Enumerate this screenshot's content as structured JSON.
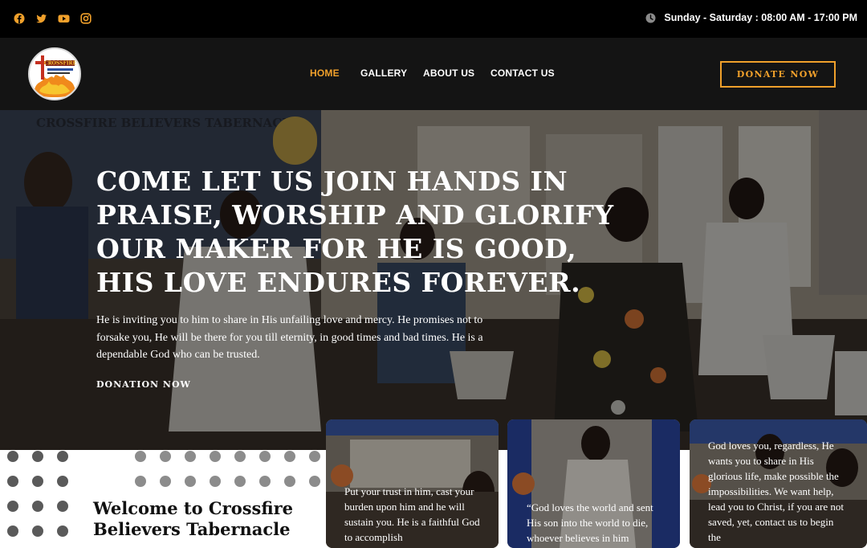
{
  "topbar": {
    "social": [
      "facebook-icon",
      "twitter-icon",
      "youtube-icon",
      "instagram-icon"
    ],
    "hours": "Sunday - Saturday : 08:00 AM - 17:00 PM"
  },
  "brand": {
    "accent": "#f0a02b",
    "logo_text": "CROSSFIRE"
  },
  "nav": {
    "items": [
      "HOME",
      "GALLERY",
      "ABOUT US",
      "CONTACT US"
    ],
    "active": "HOME",
    "donate": "DONATE NOW"
  },
  "hero": {
    "banner": "CROSSFIRE BELIEVERS TABERNACLE",
    "title": "COME LET US JOIN HANDS IN PRAISE, WORSHIP AND GLORIFY OUR MAKER FOR HE IS GOOD, HIS LOVE ENDURES FOREVER.",
    "text": "He is inviting you to him to share in His unfailing love and mercy. He promises not to forsake you, He will be there for you till eternity, in good times and bad times. He is a dependable God who can be trusted.",
    "link": "DONATION NOW"
  },
  "welcome": {
    "title": "Welcome to Crossfire Believers Tabernacle"
  },
  "cards": [
    {
      "text": "Put your trust in him, cast your burden upon him and he will sustain you. He is a faithful God to accomplish"
    },
    {
      "text": "“God loves the world and sent His son into the world to die, whoever believes in him"
    },
    {
      "text": "God loves you, regardless, He wants you to share in His glorious life, make possible the impossibilities. We want help, lead you to Christ, if you are not saved, yet, contact us to begin the"
    }
  ]
}
